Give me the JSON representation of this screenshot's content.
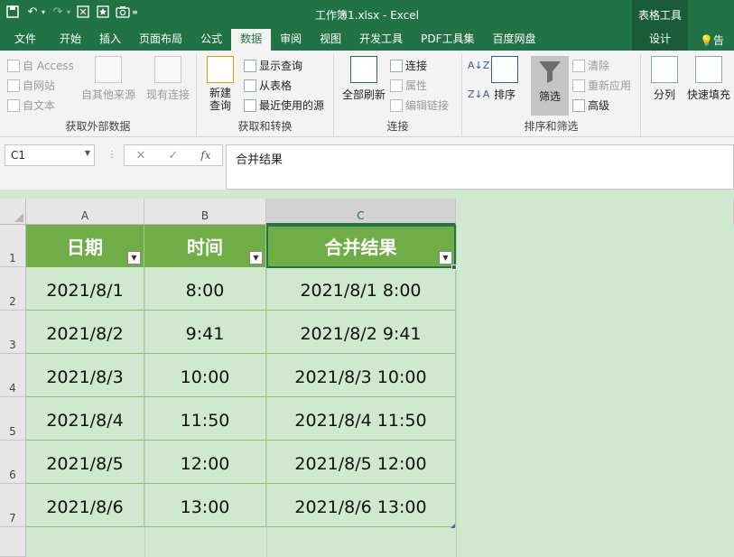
{
  "app": {
    "doc_title": "工作簿1.xlsx - Excel",
    "context_title": "表格工具"
  },
  "tabs": [
    {
      "label": "文件"
    },
    {
      "label": "开始"
    },
    {
      "label": "插入"
    },
    {
      "label": "页面布局"
    },
    {
      "label": "公式"
    },
    {
      "label": "数据",
      "active": true
    },
    {
      "label": "审阅"
    },
    {
      "label": "视图"
    },
    {
      "label": "开发工具"
    },
    {
      "label": "PDF工具集"
    },
    {
      "label": "百度网盘"
    },
    {
      "label": "设计",
      "context": true
    }
  ],
  "tell_me": "告诉",
  "ribbon": {
    "get_external": {
      "label": "获取外部数据",
      "from_access": "自 Access",
      "from_web": "自网站",
      "from_text": "自文本",
      "from_other": "自其他来源",
      "existing_conn": "现有连接"
    },
    "get_transform": {
      "label": "获取和转换",
      "new_query": "新建\n查询",
      "show_queries": "显示查询",
      "from_table": "从表格",
      "recent_sources": "最近使用的源"
    },
    "connections": {
      "label": "连接",
      "refresh_all": "全部刷新",
      "connections": "连接",
      "properties": "属性",
      "edit_links": "编辑链接"
    },
    "sort_filter": {
      "label": "排序和筛选",
      "sort": "排序",
      "filter": "筛选",
      "clear": "清除",
      "reapply": "重新应用",
      "advanced": "高级"
    },
    "data_tools": {
      "split": "分列",
      "flash_fill": "快速填充"
    }
  },
  "formula_bar": {
    "name_box": "C1",
    "formula": "合并结果"
  },
  "sheet": {
    "columns": [
      "A",
      "B",
      "C"
    ],
    "row_numbers": [
      "1",
      "2",
      "3",
      "4",
      "5",
      "6",
      "7"
    ],
    "headers": [
      "日期",
      "时间",
      "合并结果"
    ],
    "rows": [
      [
        "2021/8/1",
        "8:00",
        "2021/8/1 8:00"
      ],
      [
        "2021/8/2",
        "9:41",
        "2021/8/2 9:41"
      ],
      [
        "2021/8/3",
        "10:00",
        "2021/8/3 10:00"
      ],
      [
        "2021/8/4",
        "11:50",
        "2021/8/4 11:50"
      ],
      [
        "2021/8/5",
        "12:00",
        "2021/8/5 12:00"
      ],
      [
        "2021/8/6",
        "13:00",
        "2021/8/6 13:00"
      ]
    ],
    "filter_glyph": "▼"
  },
  "colors": {
    "excel_green": "#217346",
    "header_fill": "#70ad47",
    "body_fill": "#cfe8cf"
  }
}
